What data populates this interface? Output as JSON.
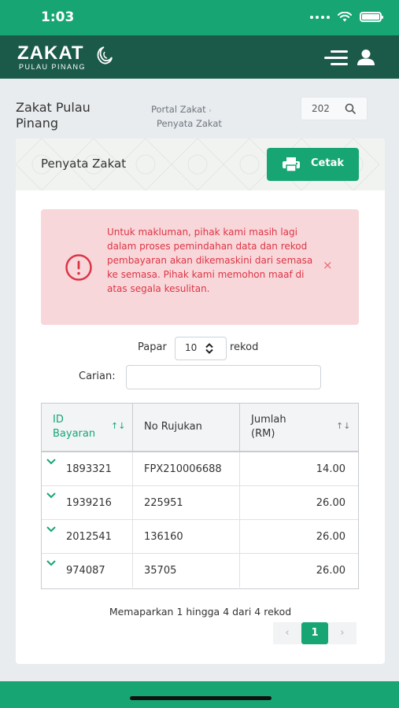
{
  "status_bar": {
    "time": "1:03"
  },
  "brand": {
    "name": "ZAKAT",
    "tagline": "PULAU PINANG"
  },
  "page": {
    "title": "Zakat Pulau Pinang",
    "breadcrumb": [
      "Portal Zakat",
      "Penyata Zakat"
    ],
    "search_value": "202"
  },
  "card": {
    "title": "Penyata Zakat",
    "print_label": "Cetak"
  },
  "alert": {
    "message": "Untuk makluman, pihak kami masih lagi dalam proses pemindahan data dan rekod pembayaran akan dikemaskini dari semasa ke semasa. Pihak kami memohon maaf di atas segala kesulitan.",
    "close_symbol": "×"
  },
  "table_controls": {
    "show_label": "Papar",
    "show_value": "10",
    "records_label": "rekod",
    "search_label": "Carian:"
  },
  "table": {
    "columns": [
      "ID Bayaran",
      "No Rujukan",
      "Jumlah (RM)"
    ],
    "rows": [
      {
        "id": "1893321",
        "ref": "FPX210006688",
        "amount": "14.00"
      },
      {
        "id": "1939216",
        "ref": "225951",
        "amount": "26.00"
      },
      {
        "id": "2012541",
        "ref": "136160",
        "amount": "26.00"
      },
      {
        "id": "974087",
        "ref": "35705",
        "amount": "26.00"
      }
    ]
  },
  "table_info": "Memaparkan 1 hingga 4 dari 4 rekod",
  "pagination": {
    "prev": "‹",
    "current": "1",
    "next": "›"
  },
  "colors": {
    "primary": "#17a673",
    "nav": "#1b5a49",
    "alert_bg": "#f8d7da",
    "alert_text": "#dc3545"
  }
}
